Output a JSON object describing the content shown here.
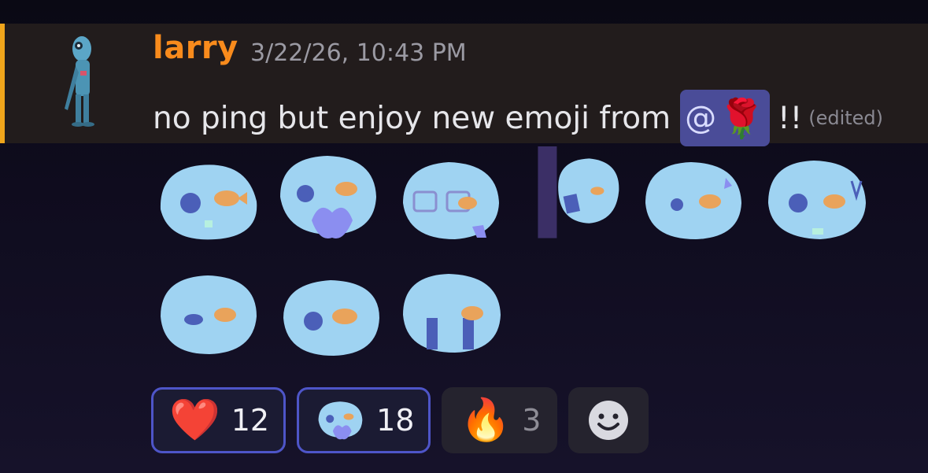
{
  "message": {
    "username": "larry",
    "timestamp": "3/22/26, 10:43 PM",
    "text_before": "no ping but enjoy new emoji from",
    "mention_at": "@",
    "mention_emoji": "🌹",
    "text_after": "!!",
    "edited": "(edited)"
  },
  "emojis": [
    "fish-head-1",
    "fish-head-2",
    "fish-head-3",
    "fish-head-4",
    "fish-head-5",
    "fish-head-6",
    "fish-head-7",
    "fish-head-8",
    "fish-head-9"
  ],
  "reactions": [
    {
      "glyph": "❤️",
      "count": "12",
      "active": true
    },
    {
      "glyph": "custom-emoji",
      "count": "18",
      "active": true
    },
    {
      "glyph": "🔥",
      "count": "3",
      "active": false
    }
  ],
  "colors": {
    "username": "#f98b1c",
    "accent_bar": "#f0a51b",
    "mention_bg": "#4a4c98",
    "reaction_border": "#4e55c8",
    "emoji_blue": "#9fd3f2"
  }
}
